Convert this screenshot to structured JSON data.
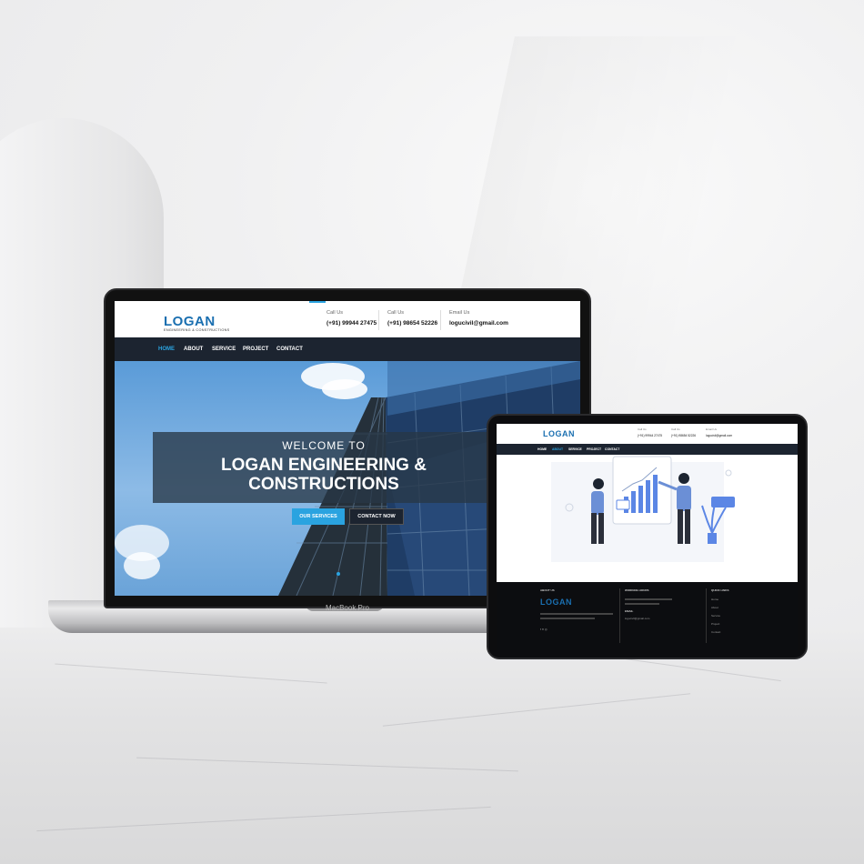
{
  "brand": {
    "logo_text": "LOGAN",
    "logo_sub": "ENGINEERING & CONSTRUCTIONS",
    "accent": "#2aa3e0",
    "nav_bg": "#1c2430"
  },
  "laptop": {
    "model_label": "MacBook Pro",
    "contacts": [
      {
        "label": "Call Us",
        "value": "(+91) 99944 27475"
      },
      {
        "label": "Call Us",
        "value": "(+91) 98654 52226"
      },
      {
        "label": "Email Us",
        "value": "logucivil@gmail.com"
      }
    ],
    "nav": [
      "HOME",
      "ABOUT",
      "SERVICE",
      "PROJECT",
      "CONTACT"
    ],
    "active_nav": "HOME",
    "hero": {
      "welcome": "WELCOME TO",
      "title_line1": "LOGAN ENGINEERING &",
      "title_line2": "CONSTRUCTIONS",
      "btn_services": "OUR SERVICES",
      "btn_contact": "CONTACT NOW"
    }
  },
  "tablet": {
    "logo_text": "LOGAN",
    "contacts": [
      {
        "label": "Call Us",
        "value": "(+91) 99944 27475"
      },
      {
        "label": "Call Us",
        "value": "(+91) 98654 52226"
      },
      {
        "label": "Email Us",
        "value": "logucivil@gmail.com"
      }
    ],
    "nav": [
      "HOME",
      "ABOUT",
      "SERVICE",
      "PROJECT",
      "CONTACT"
    ],
    "active_nav": "ABOUT",
    "footer": {
      "col1_heading": "ABOUT US",
      "col2_heading": "WORKING HOURS",
      "col2_sub": "EMAIL",
      "col2_email": "logucivil@gmail.com",
      "col3_heading": "QUICK LINKS",
      "quick_links": [
        "Home",
        "About",
        "Service",
        "Project",
        "Contact"
      ]
    }
  }
}
